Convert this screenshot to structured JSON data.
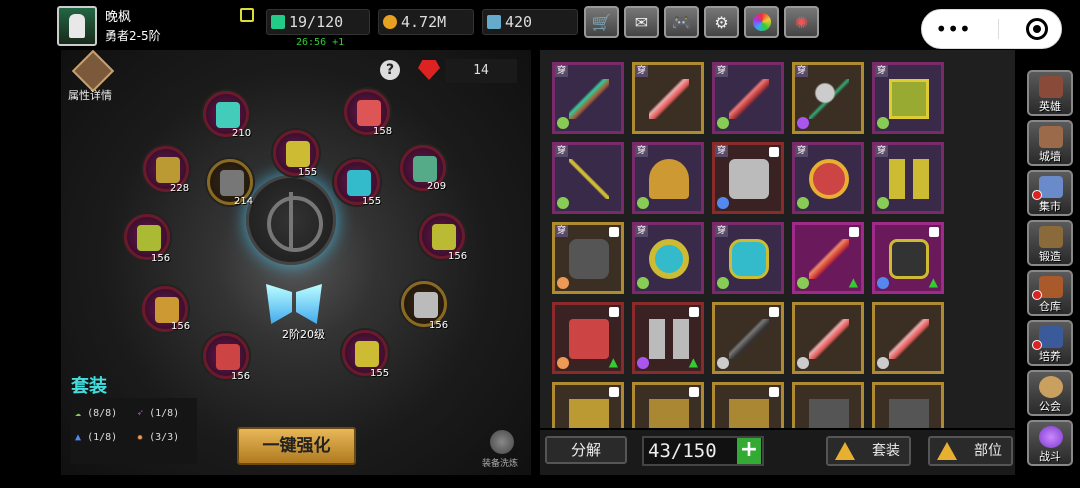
{
  "player": {
    "name": "晚枫",
    "rank": "勇者2-5阶"
  },
  "resources": {
    "stamina": "19/120",
    "gold": "4.72M",
    "diamonds": "420",
    "timer": "26:56 +1"
  },
  "toolbar": [
    {
      "name": "shop-cart-icon"
    },
    {
      "name": "mail-icon"
    },
    {
      "name": "gamepad-icon"
    },
    {
      "name": "gear-icon"
    },
    {
      "name": "color-wheel-icon"
    },
    {
      "name": "firework-icon"
    }
  ],
  "miniprogram": {
    "menu": "•••"
  },
  "left": {
    "attr_label": "属性详情",
    "gem_count": "14",
    "slots": [
      {
        "level": "210"
      },
      {
        "level": "158"
      },
      {
        "level": "228"
      },
      {
        "level": "214"
      },
      {
        "level": "155"
      },
      {
        "level": "155"
      },
      {
        "level": "209"
      },
      {
        "level": "156"
      },
      {
        "level": "156"
      },
      {
        "level": "156"
      },
      {
        "level": "156"
      },
      {
        "level": "155"
      },
      {
        "level": "156"
      }
    ],
    "wing_label": "2阶20级",
    "set_title": "套装",
    "set_rows": [
      "(8/8)",
      "(1/8)",
      "(1/8)",
      "(3/3)"
    ],
    "strengthen": "一键强化",
    "wash_label": "装备洗炼"
  },
  "inventory": {
    "wear_tag": "穿",
    "capacity": "43/150",
    "plus": "+",
    "decompose": "分解",
    "sort_set": "套装",
    "sort_part": "部位"
  },
  "nav": [
    {
      "label": "英雄",
      "color": "#8a4a3a"
    },
    {
      "label": "城墙",
      "color": "#9a6a4a"
    },
    {
      "label": "集市",
      "color": "#6a8aca"
    },
    {
      "label": "锻造",
      "color": "#8a6a3a"
    },
    {
      "label": "仓库",
      "color": "#aa5a2a"
    },
    {
      "label": "培养",
      "color": "#3a5a9a"
    },
    {
      "label": "公会",
      "color": "#caa060"
    },
    {
      "label": "战斗",
      "color": "#7a3aca"
    }
  ]
}
